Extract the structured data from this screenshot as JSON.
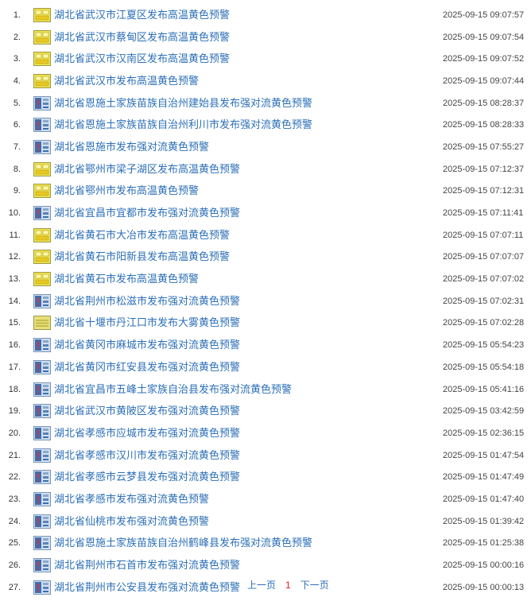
{
  "colors": {
    "link": "#2c6fb7",
    "current_page": "#e02020",
    "heat_icon": "#f0e030",
    "convect_icon": "#3a6fb0"
  },
  "alerts": [
    {
      "num": "1.",
      "icon": "heat-warning-icon",
      "title": "湖北省武汉市江夏区发布高温黄色预警",
      "time": "2025-09-15 09:07:57"
    },
    {
      "num": "2.",
      "icon": "heat-warning-icon",
      "title": "湖北省武汉市蔡甸区发布高温黄色预警",
      "time": "2025-09-15 09:07:54"
    },
    {
      "num": "3.",
      "icon": "heat-warning-icon",
      "title": "湖北省武汉市汉南区发布高温黄色预警",
      "time": "2025-09-15 09:07:52"
    },
    {
      "num": "4.",
      "icon": "heat-warning-icon",
      "title": "湖北省武汉市发布高温黄色预警",
      "time": "2025-09-15 09:07:44"
    },
    {
      "num": "5.",
      "icon": "convection-warning-icon",
      "title": "湖北省恩施土家族苗族自治州建始县发布强对流黄色预警",
      "time": "2025-09-15 08:28:37"
    },
    {
      "num": "6.",
      "icon": "convection-warning-icon",
      "title": "湖北省恩施土家族苗族自治州利川市发布强对流黄色预警",
      "time": "2025-09-15 08:28:33"
    },
    {
      "num": "7.",
      "icon": "convection-warning-icon",
      "title": "湖北省恩施市发布强对流黄色预警",
      "time": "2025-09-15 07:55:27"
    },
    {
      "num": "8.",
      "icon": "heat-warning-icon",
      "title": "湖北省鄂州市梁子湖区发布高温黄色预警",
      "time": "2025-09-15 07:12:37"
    },
    {
      "num": "9.",
      "icon": "heat-warning-icon",
      "title": "湖北省鄂州市发布高温黄色预警",
      "time": "2025-09-15 07:12:31"
    },
    {
      "num": "10.",
      "icon": "convection-warning-icon",
      "title": "湖北省宜昌市宜都市发布强对流黄色预警",
      "time": "2025-09-15 07:11:41"
    },
    {
      "num": "11.",
      "icon": "heat-warning-icon",
      "title": "湖北省黄石市大冶市发布高温黄色预警",
      "time": "2025-09-15 07:07:11"
    },
    {
      "num": "12.",
      "icon": "heat-warning-icon",
      "title": "湖北省黄石市阳新县发布高温黄色预警",
      "time": "2025-09-15 07:07:07"
    },
    {
      "num": "13.",
      "icon": "heat-warning-icon",
      "title": "湖北省黄石市发布高温黄色预警",
      "time": "2025-09-15 07:07:02"
    },
    {
      "num": "14.",
      "icon": "convection-warning-icon",
      "title": "湖北省荆州市松滋市发布强对流黄色预警",
      "time": "2025-09-15 07:02:31"
    },
    {
      "num": "15.",
      "icon": "fog-warning-icon",
      "title": "湖北省十堰市丹江口市发布大雾黄色预警",
      "time": "2025-09-15 07:02:28"
    },
    {
      "num": "16.",
      "icon": "convection-warning-icon",
      "title": "湖北省黄冈市麻城市发布强对流黄色预警",
      "time": "2025-09-15 05:54:23"
    },
    {
      "num": "17.",
      "icon": "convection-warning-icon",
      "title": "湖北省黄冈市红安县发布强对流黄色预警",
      "time": "2025-09-15 05:54:18"
    },
    {
      "num": "18.",
      "icon": "convection-warning-icon",
      "title": "湖北省宜昌市五峰土家族自治县发布强对流黄色预警",
      "time": "2025-09-15 05:41:16"
    },
    {
      "num": "19.",
      "icon": "convection-warning-icon",
      "title": "湖北省武汉市黄陂区发布强对流黄色预警",
      "time": "2025-09-15 03:42:59"
    },
    {
      "num": "20.",
      "icon": "convection-warning-icon",
      "title": "湖北省孝感市应城市发布强对流黄色预警",
      "time": "2025-09-15 02:36:15"
    },
    {
      "num": "21.",
      "icon": "convection-warning-icon",
      "title": "湖北省孝感市汉川市发布强对流黄色预警",
      "time": "2025-09-15 01:47:54"
    },
    {
      "num": "22.",
      "icon": "convection-warning-icon",
      "title": "湖北省孝感市云梦县发布强对流黄色预警",
      "time": "2025-09-15 01:47:49"
    },
    {
      "num": "23.",
      "icon": "convection-warning-icon",
      "title": "湖北省孝感市发布强对流黄色预警",
      "time": "2025-09-15 01:47:40"
    },
    {
      "num": "24.",
      "icon": "convection-warning-icon",
      "title": "湖北省仙桃市发布强对流黄色预警",
      "time": "2025-09-15 01:39:42"
    },
    {
      "num": "25.",
      "icon": "convection-warning-icon",
      "title": "湖北省恩施土家族苗族自治州鹤峰县发布强对流黄色预警",
      "time": "2025-09-15 01:25:38"
    },
    {
      "num": "26.",
      "icon": "convection-warning-icon",
      "title": "湖北省荆州市石首市发布强对流黄色预警",
      "time": "2025-09-15 00:00:16"
    },
    {
      "num": "27.",
      "icon": "convection-warning-icon",
      "title": "湖北省荆州市公安县发布强对流黄色预警",
      "time": "2025-09-15 00:00:13"
    }
  ],
  "pagination": {
    "prev_label": "上一页",
    "current_page": "1",
    "next_label": "下一页"
  }
}
